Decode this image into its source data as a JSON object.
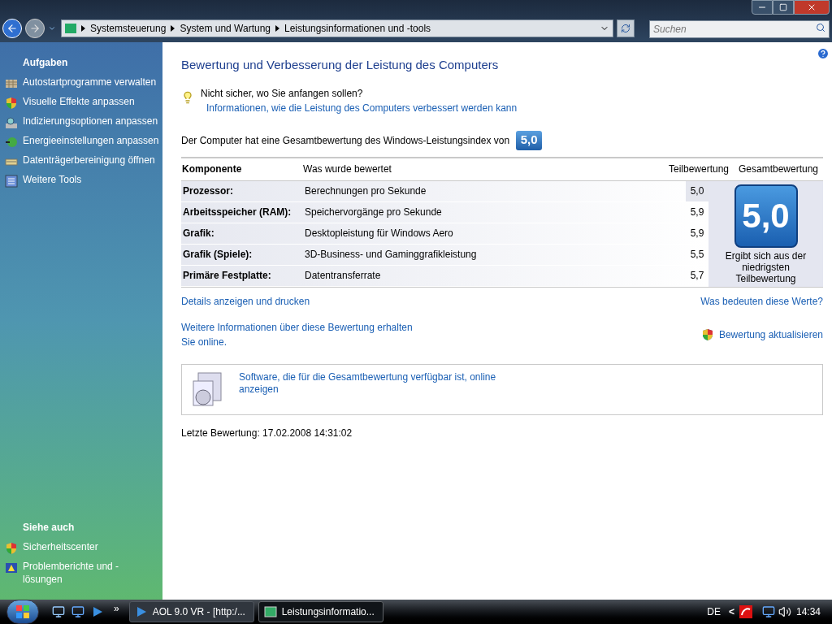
{
  "address_bar": {
    "breadcrumbs": [
      "Systemsteuerung",
      "System und Wartung",
      "Leistungsinformationen und -tools"
    ],
    "search_placeholder": "Suchen"
  },
  "sidebar": {
    "tasks_title": "Aufgaben",
    "tasks": [
      {
        "label": "Autostartprogramme verwalten",
        "kind": "grid"
      },
      {
        "label": "Visuelle Effekte anpassen",
        "kind": "shield"
      },
      {
        "label": "Indizierungsoptionen anpassen",
        "kind": "index"
      },
      {
        "label": "Energieeinstellungen anpassen",
        "kind": "power"
      },
      {
        "label": "Datenträgerbereinigung öffnen",
        "kind": "disk"
      },
      {
        "label": "Weitere Tools",
        "kind": "tools"
      }
    ],
    "see_also_title": "Siehe auch",
    "see_also": [
      {
        "label": "Sicherheitscenter",
        "kind": "shield"
      },
      {
        "label": "Problemberichte und -lösungen",
        "kind": "report"
      }
    ]
  },
  "main": {
    "title": "Bewertung und Verbesserung der Leistung des Computers",
    "tip": "Nicht sicher, wo Sie anfangen sollen?",
    "tip_link": "Informationen, wie die Leistung des Computers verbessert werden kann",
    "overall_text": "Der Computer hat eine Gesamtbewertung des Windows-Leistungsindex von",
    "overall_badge": "5,0",
    "table": {
      "columns": [
        "Komponente",
        "Was wurde bewertet",
        "Teilbewertung",
        "Gesamtbewertung"
      ],
      "rows": [
        {
          "component": "Prozessor:",
          "rated": "Berechnungen pro Sekunde",
          "score": "5,0",
          "lowest": true
        },
        {
          "component": "Arbeitsspeicher (RAM):",
          "rated": "Speichervorgänge pro Sekunde",
          "score": "5,9",
          "lowest": false
        },
        {
          "component": "Grafik:",
          "rated": "Desktopleistung für Windows Aero",
          "score": "5,9",
          "lowest": false
        },
        {
          "component": "Grafik (Spiele):",
          "rated": "3D-Business- und Gaminggrafikleistung",
          "score": "5,5",
          "lowest": false
        },
        {
          "component": "Primäre Festplatte:",
          "rated": "Datentransferrate",
          "score": "5,7",
          "lowest": false
        }
      ],
      "overall_score": "5,0",
      "overall_note": "Ergibt sich aus der niedrigsten Teilbewertung"
    },
    "details_link": "Details anzeigen und drucken",
    "meaning_link": "Was bedeuten diese Werte?",
    "more_info_link": "Weitere Informationen über diese Bewertung erhalten",
    "online_link": "Sie online.",
    "update_link": "Bewertung aktualisieren",
    "software_link": "Software, die für die Gesamtbewertung verfügbar ist, online anzeigen",
    "last_rating": "Letzte Bewertung: 17.02.2008 14:31:02"
  },
  "taskbar": {
    "overflow": "»",
    "buttons": [
      {
        "label": "AOL 9.0 VR - [http:/...",
        "selected": false,
        "kind": "aol"
      },
      {
        "label": "Leistungsinformatio...",
        "selected": true,
        "kind": "perf"
      }
    ],
    "language": "DE",
    "tray_arrow": "<",
    "clock": "14:34"
  }
}
